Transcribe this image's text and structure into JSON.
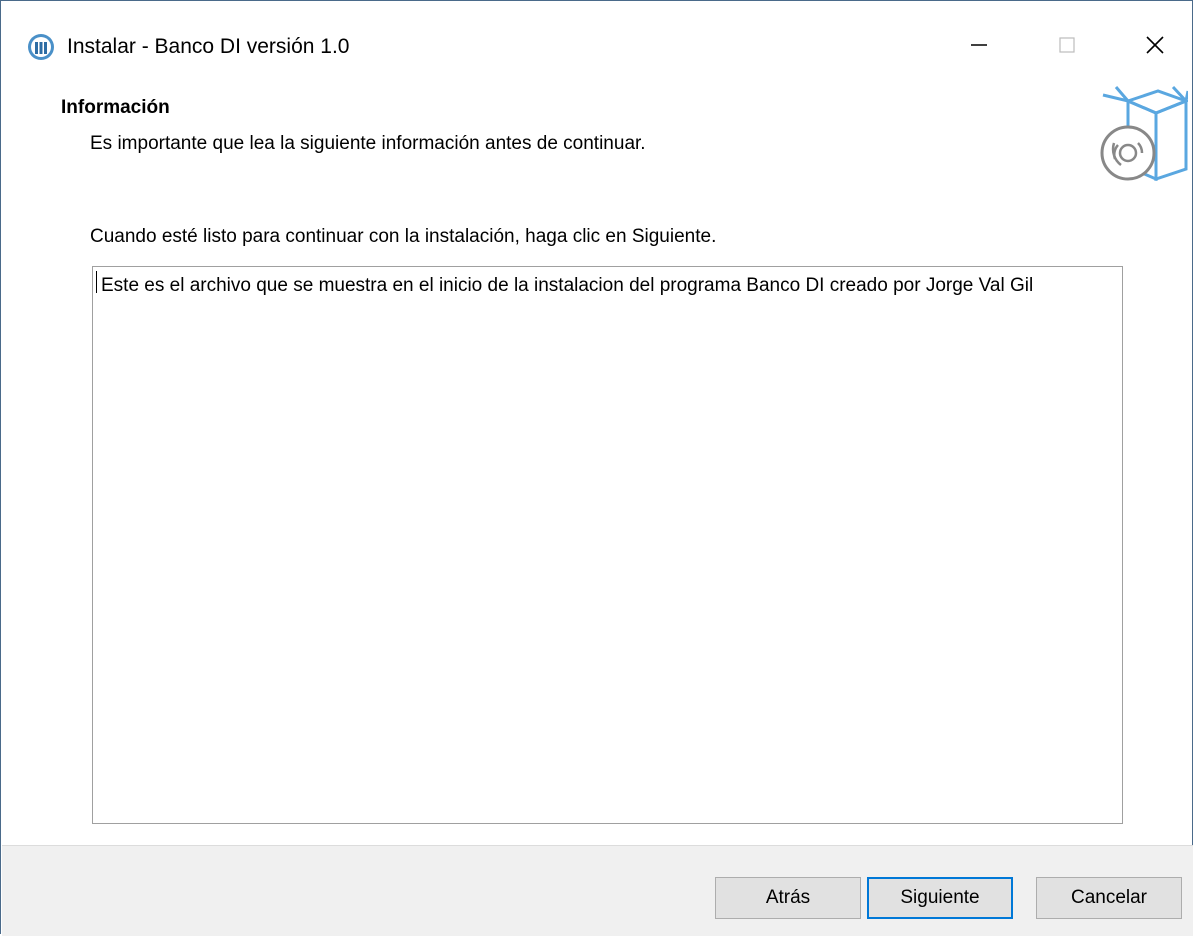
{
  "window": {
    "title": "Instalar - Banco DI versión 1.0"
  },
  "header": {
    "title": "Información",
    "subtitle": "Es importante que lea la siguiente información antes de continuar."
  },
  "instruction": "Cuando esté listo para continuar con la instalación, haga clic en Siguiente.",
  "info_text": "Este es el archivo que se muestra en el inicio de la instalacion del programa Banco DI creado por Jorge Val Gil",
  "buttons": {
    "back": "Atrás",
    "next": "Siguiente",
    "cancel": "Cancelar"
  },
  "colors": {
    "accent": "#0078d7",
    "footer_bg": "#f0f0f0",
    "button_bg": "#e1e1e1",
    "icon_blue": "#5aa7e0"
  }
}
